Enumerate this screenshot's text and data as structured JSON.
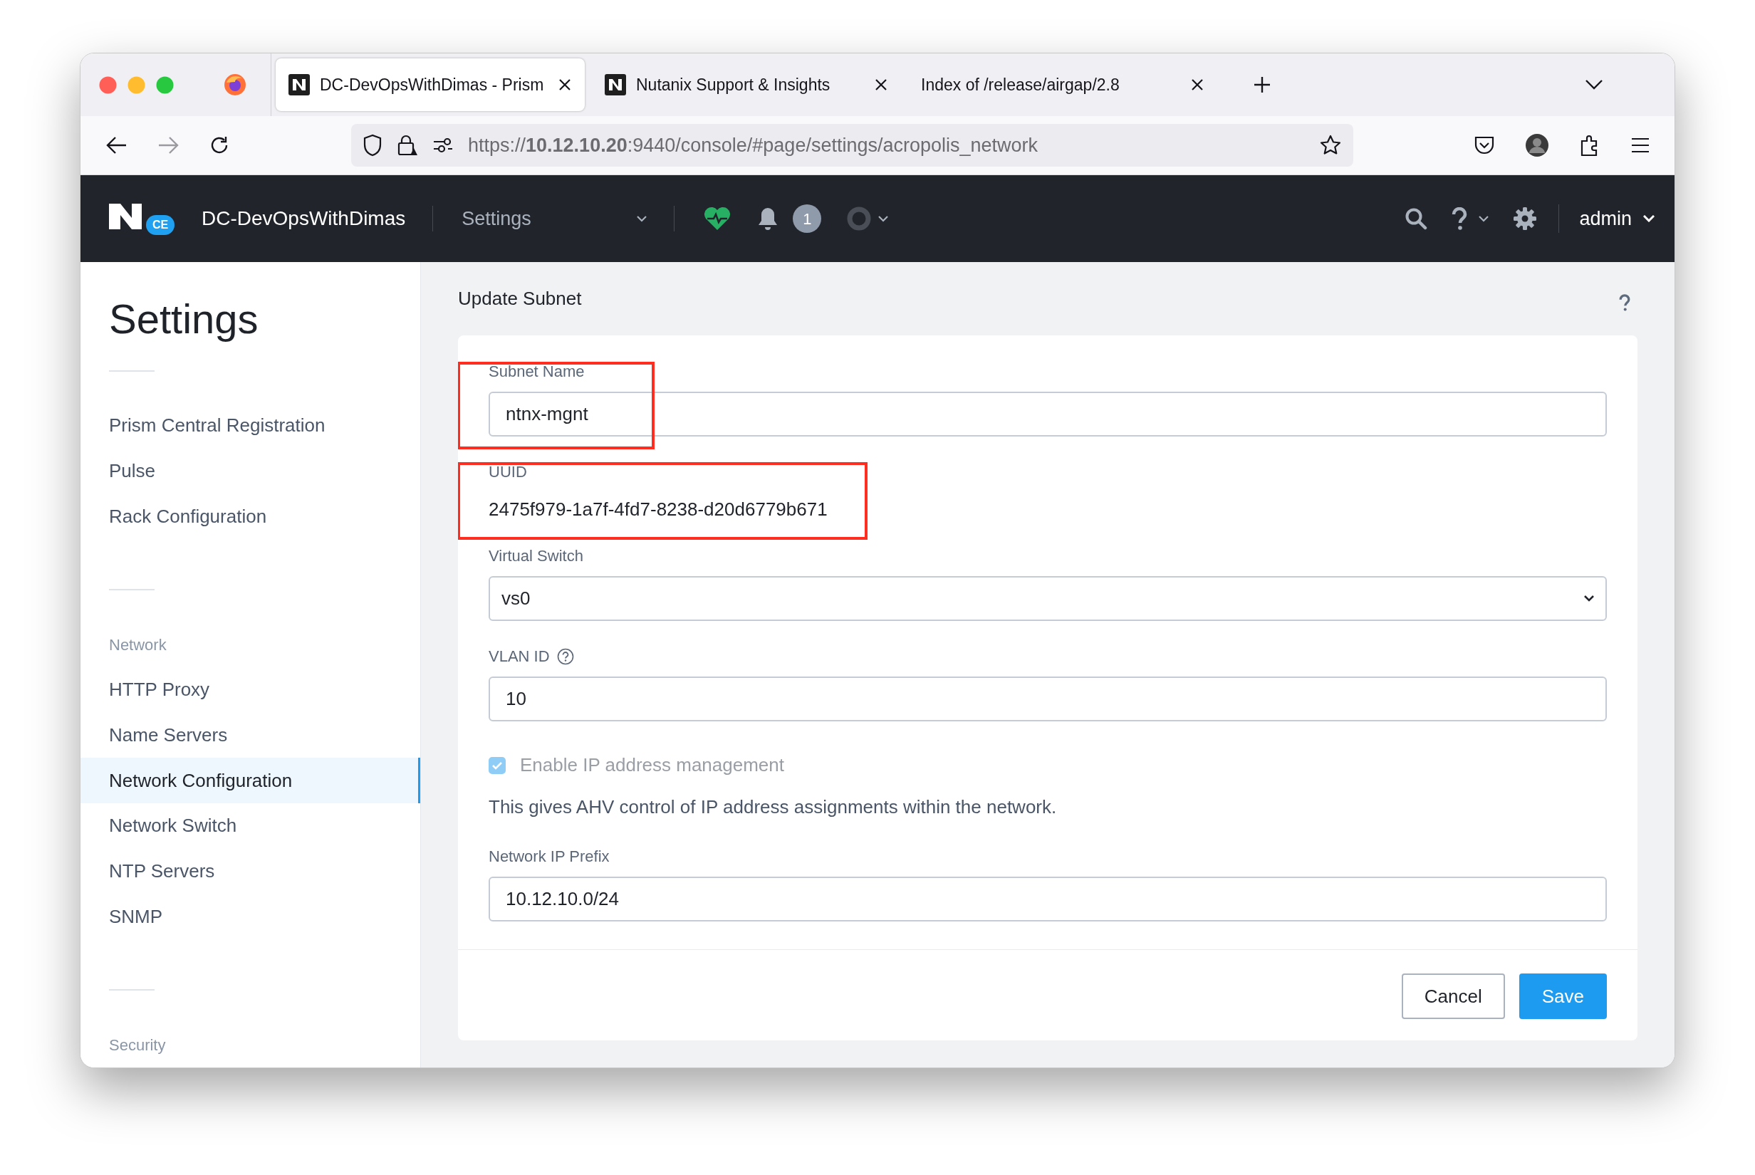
{
  "browser": {
    "tabs": [
      {
        "title": "DC-DevOpsWithDimas - Prism",
        "selected": true,
        "favicon": true
      },
      {
        "title": "Nutanix Support & Insights",
        "selected": false,
        "favicon": true
      },
      {
        "title": "Index of /release/airgap/2.8",
        "selected": false,
        "favicon": false
      }
    ],
    "url": "https://**10.12.10.20**:9440/console/#page/settings/acropolis_network"
  },
  "header": {
    "logo_badge": "CE",
    "cluster": "DC-DevOpsWithDimas",
    "menu": "Settings",
    "alerts_badge": "1",
    "user": "admin"
  },
  "sidebar": {
    "title": "Settings",
    "sections": [
      {
        "items": [
          {
            "label": "Prism Central Registration",
            "selected": false
          },
          {
            "label": "Pulse",
            "selected": false
          },
          {
            "label": "Rack Configuration",
            "selected": false
          }
        ]
      },
      {
        "heading": "Network",
        "items": [
          {
            "label": "HTTP Proxy",
            "selected": false
          },
          {
            "label": "Name Servers",
            "selected": false
          },
          {
            "label": "Network Configuration",
            "selected": true
          },
          {
            "label": "Network Switch",
            "selected": false
          },
          {
            "label": "NTP Servers",
            "selected": false
          },
          {
            "label": "SNMP",
            "selected": false
          }
        ]
      },
      {
        "heading": "Security"
      }
    ]
  },
  "dialog": {
    "title": "Update Subnet",
    "fields": [
      {
        "kind": "text",
        "label": "Subnet Name",
        "value": "ntnx-mgnt",
        "highlighted": true
      },
      {
        "kind": "readonly",
        "label": "UUID",
        "value": "2475f979-1a7f-4fd7-8238-d20d6779b671",
        "highlighted": true
      },
      {
        "kind": "select",
        "label": "Virtual Switch",
        "value": "vs0"
      },
      {
        "kind": "text",
        "label": "VLAN ID",
        "value": "10",
        "help": true
      },
      {
        "kind": "checkbox",
        "label": "Enable IP address management",
        "checked": true,
        "disabled": true
      },
      {
        "kind": "note",
        "text": "This gives AHV control of IP address assignments within the network."
      },
      {
        "kind": "text",
        "label": "Network IP Prefix",
        "value": "10.12.10.0/24"
      }
    ],
    "buttons": [
      {
        "label": "Cancel",
        "kind": "secondary"
      },
      {
        "label": "Save",
        "kind": "primary"
      }
    ]
  }
}
